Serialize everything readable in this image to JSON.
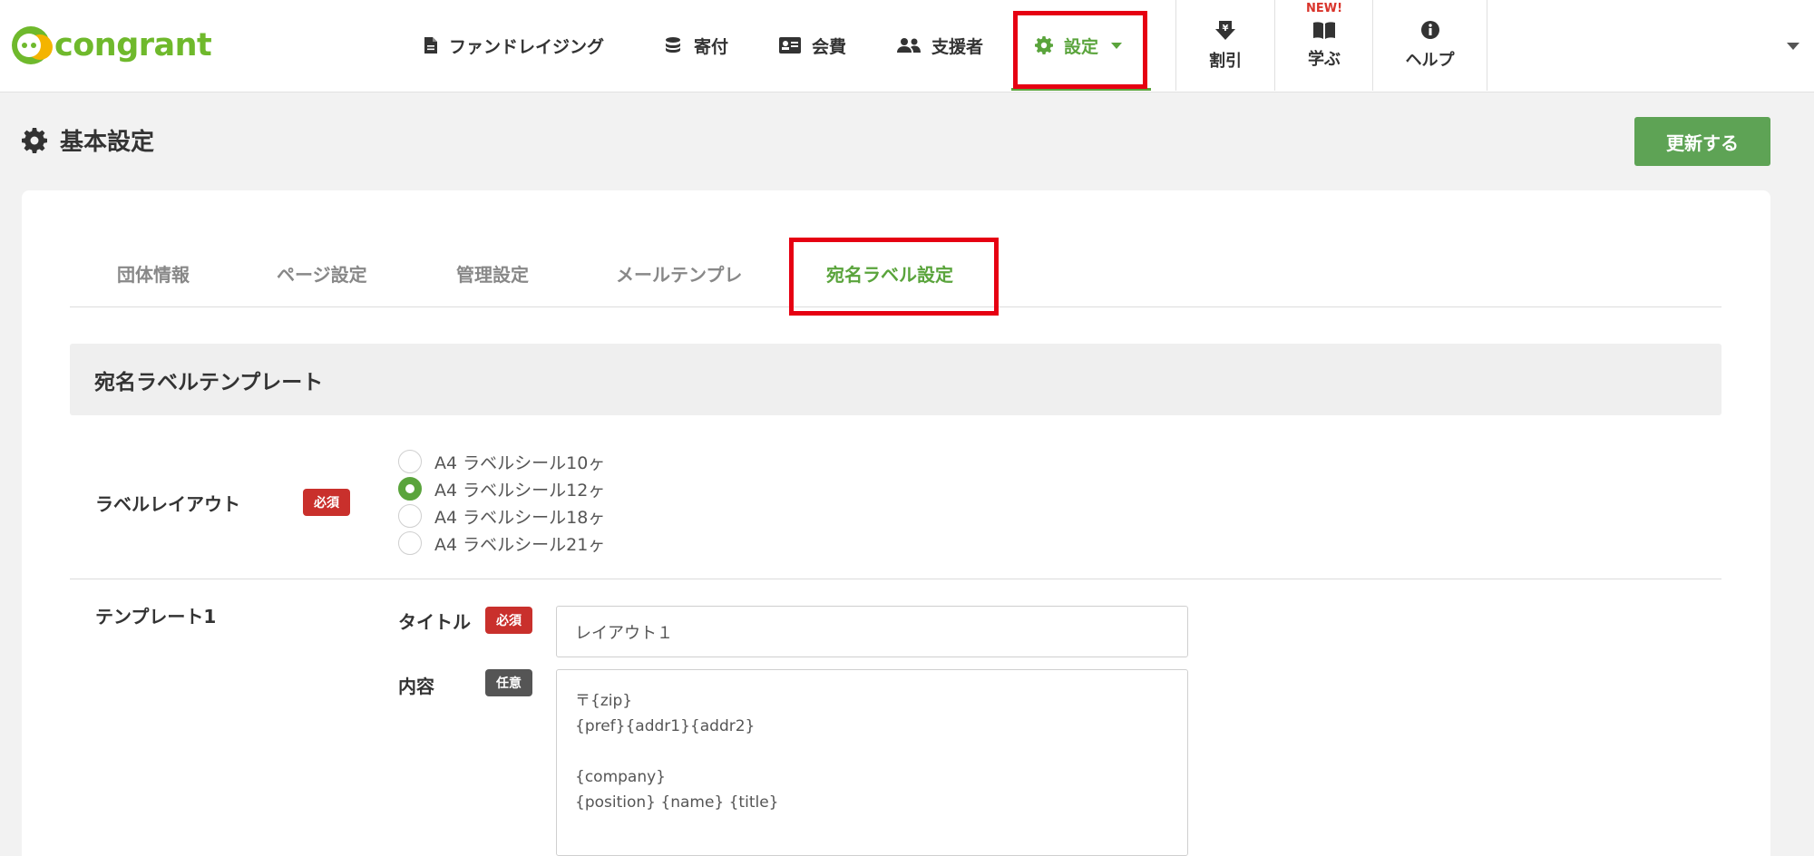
{
  "header": {
    "logo_text": "congrant",
    "nav": [
      {
        "label": "ファンドレイジング",
        "icon": "document-icon"
      },
      {
        "label": "寄付",
        "icon": "coins-icon"
      },
      {
        "label": "会費",
        "icon": "id-card-icon"
      },
      {
        "label": "支援者",
        "icon": "users-icon"
      },
      {
        "label": "設定",
        "icon": "gear-icon",
        "active": true
      }
    ],
    "square_nav": [
      {
        "label": "割引",
        "icon": "yen-down-icon"
      },
      {
        "label": "学ぶ",
        "icon": "book-icon",
        "badge": "NEW!"
      },
      {
        "label": "ヘルプ",
        "icon": "info-icon"
      }
    ]
  },
  "page": {
    "title": "基本設定",
    "update_button": "更新する"
  },
  "tabs": [
    {
      "label": "団体情報"
    },
    {
      "label": "ページ設定"
    },
    {
      "label": "管理設定"
    },
    {
      "label": "メールテンプレ"
    },
    {
      "label": "宛名ラベル設定",
      "active": true
    }
  ],
  "section": {
    "title": "宛名ラベルテンプレート"
  },
  "label_layout": {
    "label": "ラベルレイアウト",
    "badge": "必須",
    "options": [
      {
        "label": "A4 ラベルシール10ヶ",
        "checked": false
      },
      {
        "label": "A4 ラベルシール12ヶ",
        "checked": true
      },
      {
        "label": "A4 ラベルシール18ヶ",
        "checked": false
      },
      {
        "label": "A4 ラベルシール21ヶ",
        "checked": false
      }
    ]
  },
  "template1": {
    "label": "テンプレート1",
    "title_label": "タイトル",
    "title_badge": "必須",
    "title_value": "レイアウト１",
    "content_label": "内容",
    "content_badge": "任意",
    "content_lines": [
      "〒{zip}",
      "{pref}{addr1}{addr2}",
      "",
      "{company}",
      "{position} {name} {title}"
    ]
  },
  "colors": {
    "brand_green": "#5aa43c",
    "button_green": "#5ea355",
    "required_red": "#c9302c",
    "highlight_red": "#e60012"
  }
}
